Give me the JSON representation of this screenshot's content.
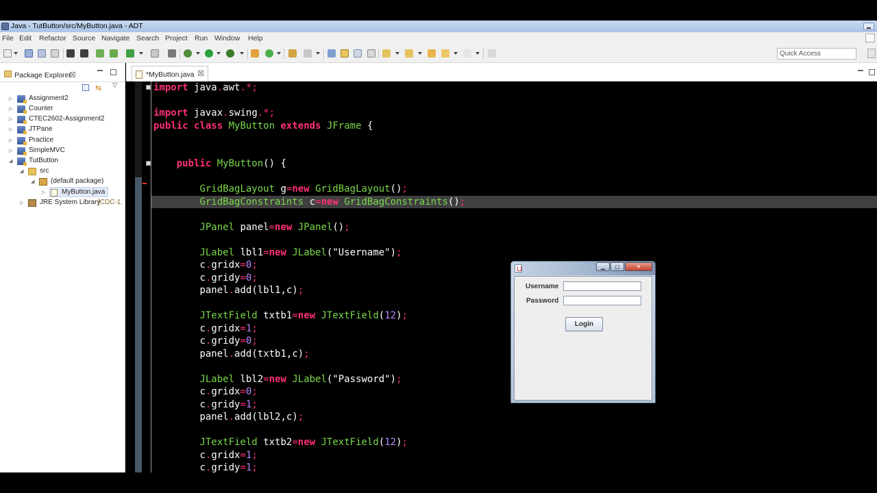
{
  "window": {
    "title": "Java - TutButton/src/MyButton.java - ADT"
  },
  "menu": [
    "File",
    "Edit",
    "Refactor",
    "Source",
    "Navigate",
    "Search",
    "Project",
    "Run",
    "Window",
    "Help"
  ],
  "toolbar": {
    "quick_access_placeholder": "Quick Access"
  },
  "package_explorer": {
    "tab_label": "Package Explorer",
    "tab_close": "☒",
    "tree": [
      {
        "label": "Assignment2",
        "icon": "project-icon",
        "twisty": "▷"
      },
      {
        "label": "Counter",
        "icon": "project-icon",
        "twisty": "▷"
      },
      {
        "label": "CTEC2602-Assignment2",
        "icon": "project-icon",
        "twisty": "▷"
      },
      {
        "label": "JTPane",
        "icon": "project-icon",
        "twisty": "▷"
      },
      {
        "label": "Practice",
        "icon": "project-icon",
        "twisty": "▷"
      },
      {
        "label": "SimpleMVC",
        "icon": "project-icon",
        "twisty": "▷"
      },
      {
        "label": "TutButton",
        "icon": "project-icon",
        "twisty": "◢"
      },
      {
        "label": "src",
        "icon": "folder-icon",
        "twisty": "◢"
      },
      {
        "label": "(default package)",
        "icon": "package-icon",
        "twisty": "◢"
      },
      {
        "label": "MyButton.java",
        "icon": "java-file-icon",
        "twisty": "▷"
      },
      {
        "label": "JRE System Library",
        "suffix": "[CDC-1.",
        "icon": "library-icon",
        "twisty": "▷"
      }
    ]
  },
  "editor": {
    "tab_label": "*MyButton.java",
    "tab_close": "☒"
  },
  "code_lines": [
    "import java.awt.*;",
    "",
    "import javax.swing.*;",
    "public class MyButton extends JFrame {",
    "",
    "",
    "    public MyButton() {",
    "",
    "        GridBagLayout g=new GridBagLayout();",
    "        GridBagConstraints c=new GridBagConstraints();",
    "",
    "        JPanel panel=new JPanel();",
    "",
    "        JLabel lbl1=new JLabel(\"Username\");",
    "        c.gridx=0;",
    "        c.gridy=0;",
    "        panel.add(lbl1,c);",
    "",
    "        JTextField txtb1=new JTextField(12);",
    "        c.gridx=1;",
    "        c.gridy=0;",
    "        panel.add(txtb1,c);",
    "",
    "        JLabel lbl2=new JLabel(\"Password\");",
    "        c.gridx=0;",
    "        c.gridy=1;",
    "        panel.add(lbl2,c);",
    "",
    "        JTextField txtb2=new JTextField(12);",
    "        c.gridx=1;",
    "        c.gridy=1;"
  ],
  "swing_window": {
    "username_label": "Username",
    "password_label": "Password",
    "login_button": "Login",
    "username_value": "",
    "password_value": ""
  },
  "colors": {
    "keyword": "#ff2f7a",
    "type": "#79d84a",
    "method": "#f3e173",
    "editor_background": "#000000",
    "highlight_line": "#404040"
  }
}
